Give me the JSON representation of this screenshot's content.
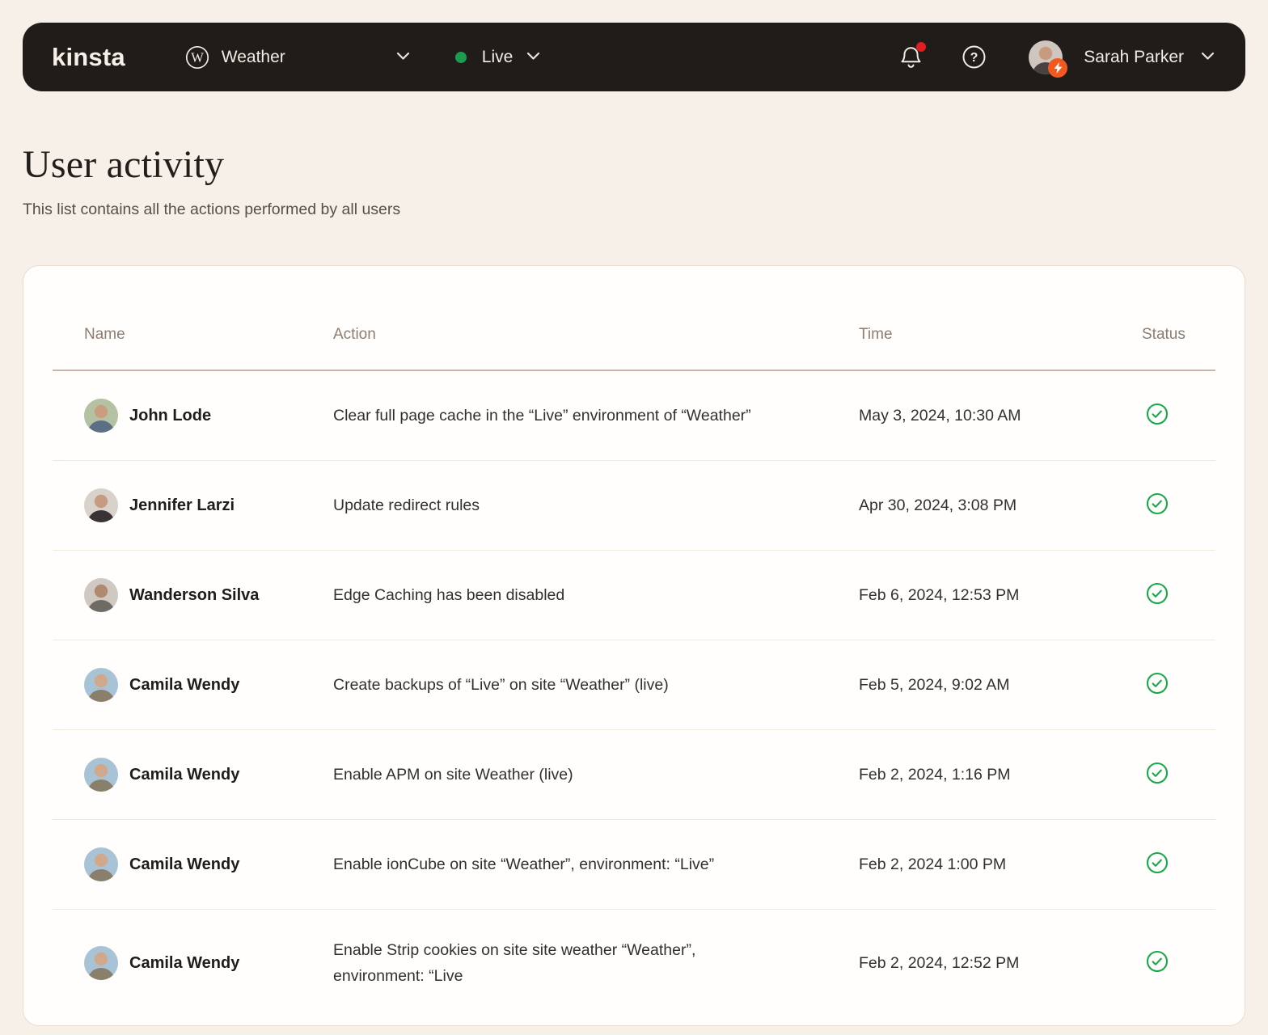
{
  "topbar": {
    "brand": "kinsta",
    "site_selector": {
      "icon": "wordpress",
      "label": "Weather"
    },
    "env_selector": {
      "label": "Live",
      "status_dot_color": "#1d9b4e"
    },
    "notifications": {
      "unread_badge_color": "#e02020"
    },
    "user": {
      "name": "Sarah Parker",
      "badge_color": "#f1591f"
    }
  },
  "page": {
    "title": "User activity",
    "subtitle": "This list contains all the actions performed by all users"
  },
  "colors": {
    "page_background": "#f6f0e9",
    "topbar_background": "#201c19",
    "card_background": "#fffefc",
    "card_border": "#eadcd0",
    "header_divider": "#c9b6a8",
    "row_divider": "#f2e8de",
    "status_success": "#17a94a"
  },
  "table": {
    "columns": [
      "Name",
      "Action",
      "Time",
      "Status"
    ],
    "rows": [
      {
        "name": "John Lode",
        "action": "Clear full page cache in the “Live” environment of “Weather”",
        "time": "May 3, 2024, 10:30 AM",
        "status": "success",
        "avatar": {
          "bg": "#b4c2a3",
          "skin": "#c99e80",
          "shirt": "#5d6f85"
        }
      },
      {
        "name": "Jennifer Larzi",
        "action": "Update redirect rules",
        "time": "Apr 30, 2024, 3:08 PM",
        "status": "success",
        "avatar": {
          "bg": "#d8d2cb",
          "skin": "#c79b82",
          "shirt": "#3a3335"
        }
      },
      {
        "name": "Wanderson Silva",
        "action": "Edge Caching has been disabled",
        "time": "Feb 6, 2024, 12:53 PM",
        "status": "success",
        "avatar": {
          "bg": "#cfc9c2",
          "skin": "#b08a6f",
          "shirt": "#6f6a64"
        }
      },
      {
        "name": "Camila Wendy",
        "action": "Create backups of “Live” on site “Weather” (live)",
        "time": "Feb 5, 2024, 9:02 AM",
        "status": "success",
        "avatar": {
          "bg": "#a9c3d6",
          "skin": "#d0a98c",
          "shirt": "#8a7f6a"
        }
      },
      {
        "name": "Camila Wendy",
        "action": "Enable APM on site Weather (live)",
        "time": "Feb 2, 2024, 1:16 PM",
        "status": "success",
        "avatar": {
          "bg": "#a9c3d6",
          "skin": "#d0a98c",
          "shirt": "#8a7f6a"
        }
      },
      {
        "name": "Camila Wendy",
        "action": "Enable ionCube on site “Weather”, environment: “Live”",
        "time": "Feb 2, 2024 1:00 PM",
        "status": "success",
        "avatar": {
          "bg": "#a9c3d6",
          "skin": "#d0a98c",
          "shirt": "#8a7f6a"
        }
      },
      {
        "name": "Camila Wendy",
        "action": "Enable Strip cookies on site site weather “Weather”, environment: “Live",
        "time": "Feb 2, 2024, 12:52 PM",
        "status": "success",
        "avatar": {
          "bg": "#a9c3d6",
          "skin": "#d0a98c",
          "shirt": "#8a7f6a"
        }
      }
    ]
  }
}
